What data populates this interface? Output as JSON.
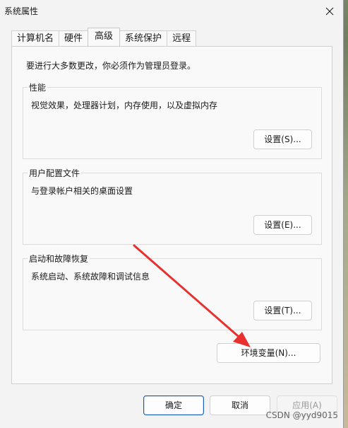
{
  "window": {
    "title": "系统属性"
  },
  "tabs": [
    {
      "label": "计算机名"
    },
    {
      "label": "硬件"
    },
    {
      "label": "高级"
    },
    {
      "label": "系统保护"
    },
    {
      "label": "远程"
    }
  ],
  "active_tab": "高级",
  "panel": {
    "admin_note": "要进行大多数更改，你必须作为管理员登录。",
    "groups": [
      {
        "label": "性能",
        "description": "视觉效果，处理器计划，内存使用，以及虚拟内存",
        "button": "设置(S)..."
      },
      {
        "label": "用户配置文件",
        "description": "与登录帐户相关的桌面设置",
        "button": "设置(E)..."
      },
      {
        "label": "启动和故障恢复",
        "description": "系统启动、系统故障和调试信息",
        "button": "设置(T)..."
      }
    ],
    "env_button": "环境变量(N)..."
  },
  "footer": {
    "ok": "确定",
    "cancel": "取消",
    "apply": "应用(A)"
  },
  "watermark": "CSDN @yyd9015",
  "colors": {
    "annotation_arrow": "#e8302f",
    "primary_border": "#1b5fb8"
  }
}
